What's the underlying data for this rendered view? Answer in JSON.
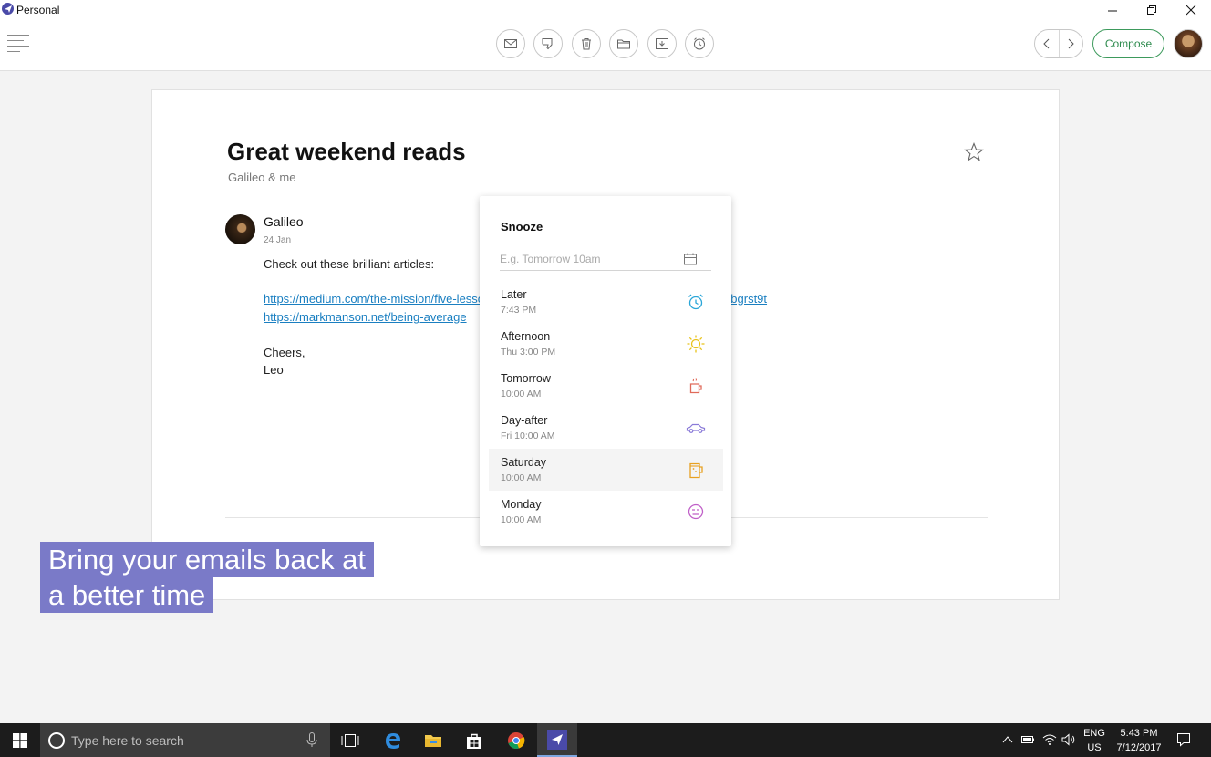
{
  "window": {
    "title": "Personal"
  },
  "email": {
    "subject": "Great weekend reads",
    "participants": "Galileo & me",
    "sender": "Galileo",
    "date": "24 Jan",
    "intro": "Check out these brilliant articles:",
    "link1": "https://medium.com/the-mission/five-lessons-that-will-change-your-life-aa8844e08bf2#.wjbgrst9t",
    "link2": "https://markmanson.net/being-average",
    "signoff": "Cheers,",
    "signature": "Leo"
  },
  "toolbar": {
    "compose_label": "Compose"
  },
  "snooze": {
    "title": "Snooze",
    "placeholder": "E.g. Tomorrow 10am",
    "options": [
      {
        "label": "Later",
        "time": "7:43 PM",
        "icon": "alarm-clock-icon",
        "color": "#2aa6d8"
      },
      {
        "label": "Afternoon",
        "time": "Thu 3:00 PM",
        "icon": "sun-icon",
        "color": "#e8c21a"
      },
      {
        "label": "Tomorrow",
        "time": "10:00 AM",
        "icon": "coffee-cup-icon",
        "color": "#e06a5a"
      },
      {
        "label": "Day-after",
        "time": "Fri 10:00 AM",
        "icon": "car-icon",
        "color": "#8a7ad8"
      },
      {
        "label": "Saturday",
        "time": "10:00 AM",
        "icon": "beer-icon",
        "color": "#e8a020"
      },
      {
        "label": "Monday",
        "time": "10:00 AM",
        "icon": "meh-face-icon",
        "color": "#c060c8"
      }
    ]
  },
  "caption": {
    "line1": "Bring your emails back at",
    "line2": "a better time",
    "color": "#7a7ac8"
  },
  "taskbar": {
    "search_placeholder": "Type here to search",
    "lang1": "ENG",
    "lang2": "US",
    "time": "5:43 PM",
    "date": "7/12/2017"
  }
}
